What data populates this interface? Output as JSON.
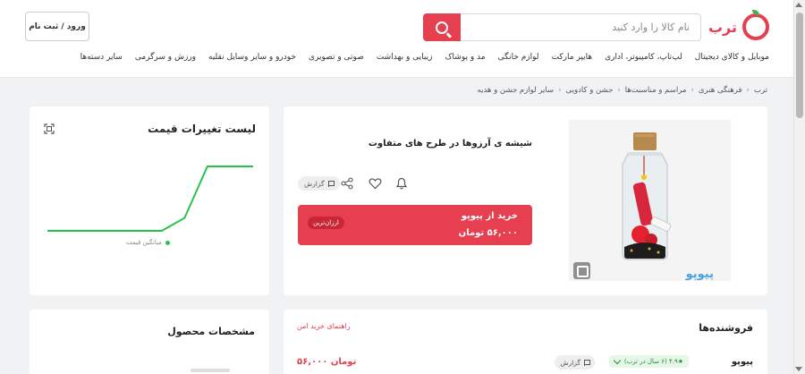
{
  "brand": {
    "name": "ترب",
    "color": "#e53f50",
    "leaf_color": "#3cb54a"
  },
  "search": {
    "placeholder": "نام کالا را وارد کنید",
    "value": ""
  },
  "header": {
    "login_label": "ورود / ثبت نام"
  },
  "nav": {
    "items": [
      "موبایل و کالای دیجیتال",
      "لپ‌تاپ، کامپیوتر، اداری",
      "هایپر مارکت",
      "لوازم خانگی",
      "مد و پوشاک",
      "زیبایی و بهداشت",
      "صوتی و تصویری",
      "خودرو و سایر وسایل نقلیه",
      "ورزش و سرگرمی",
      "سایر دسته‌ها"
    ]
  },
  "breadcrumb": [
    "ترب",
    "فرهنگی هنری",
    "مراسم و مناسبت‌ها",
    "جشن و کادویی",
    "سایر لوازم جشن و هدیه"
  ],
  "product": {
    "title": "شیشه ی آرزوها در طرح های متفاوت",
    "report_label": "گزارش",
    "image_watermark": "پیوپو"
  },
  "buy_box": {
    "title": "خرید از پیوپو",
    "price": "۵۶,۰۰۰ تومان",
    "badge": "ارزان‌ترین"
  },
  "price_chart": {
    "title": "لیست تغییرات قیمت",
    "legend": "میانگین قیمت",
    "line_color": "#27c24c"
  },
  "chart_data": {
    "type": "line",
    "title": "لیست تغییرات قیمت",
    "series": [
      {
        "name": "میانگین قیمت",
        "values": [
          0.0,
          0.0,
          0.0,
          0.0,
          0.0,
          0.0,
          0.2,
          1.0,
          1.0,
          1.0
        ]
      }
    ],
    "x": [
      0,
      1,
      2,
      3,
      4,
      5,
      6,
      7,
      8,
      9
    ],
    "ylim": [
      0,
      1
    ],
    "grid": false,
    "legend_position": "bottom"
  },
  "sellers": {
    "title": "فروشنده‌ها",
    "guide_link": "راهنمای خرید امن",
    "rows": [
      {
        "name": "پیوپو",
        "rating": "★۴.۹ (۶ سال در ترب)",
        "report_label": "گزارش",
        "price": "۵۶,۰۰۰ تومان"
      }
    ]
  },
  "specs": {
    "title": "مشخصات محصول"
  }
}
